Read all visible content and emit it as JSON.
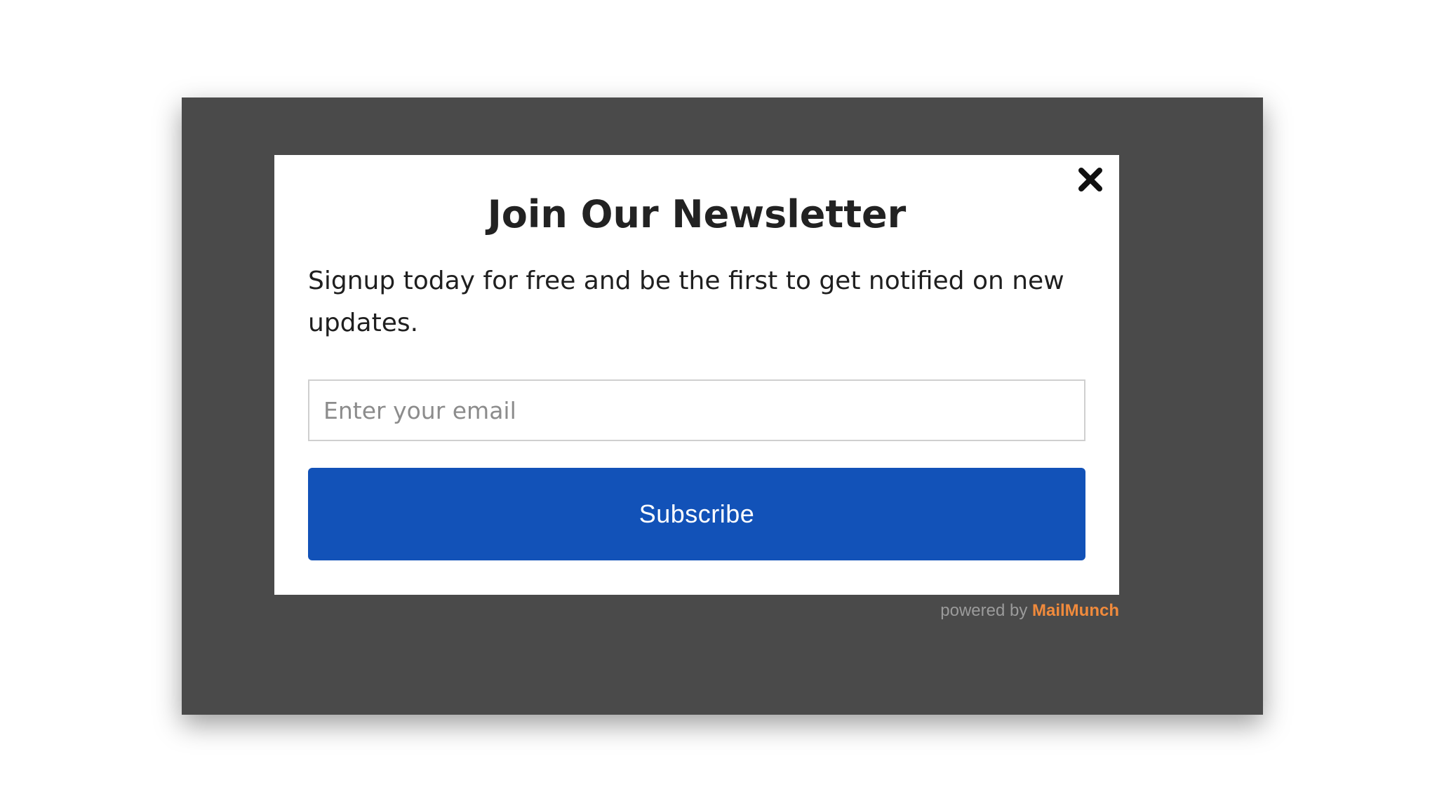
{
  "popup": {
    "title": "Join Our Newsletter",
    "description": "Signup today for free and be the first to get notified on new updates.",
    "email_placeholder": "Enter your email",
    "email_value": "",
    "subscribe_label": "Subscribe",
    "close_icon": "close-icon"
  },
  "footer": {
    "powered_by_text": "powered by",
    "brand": "MailMunch"
  },
  "colors": {
    "overlay_background": "#4a4a4a",
    "modal_background": "#ffffff",
    "button_background": "#1252b8",
    "button_text": "#ffffff",
    "brand_accent": "#f08a3c",
    "title_text": "#222222"
  }
}
